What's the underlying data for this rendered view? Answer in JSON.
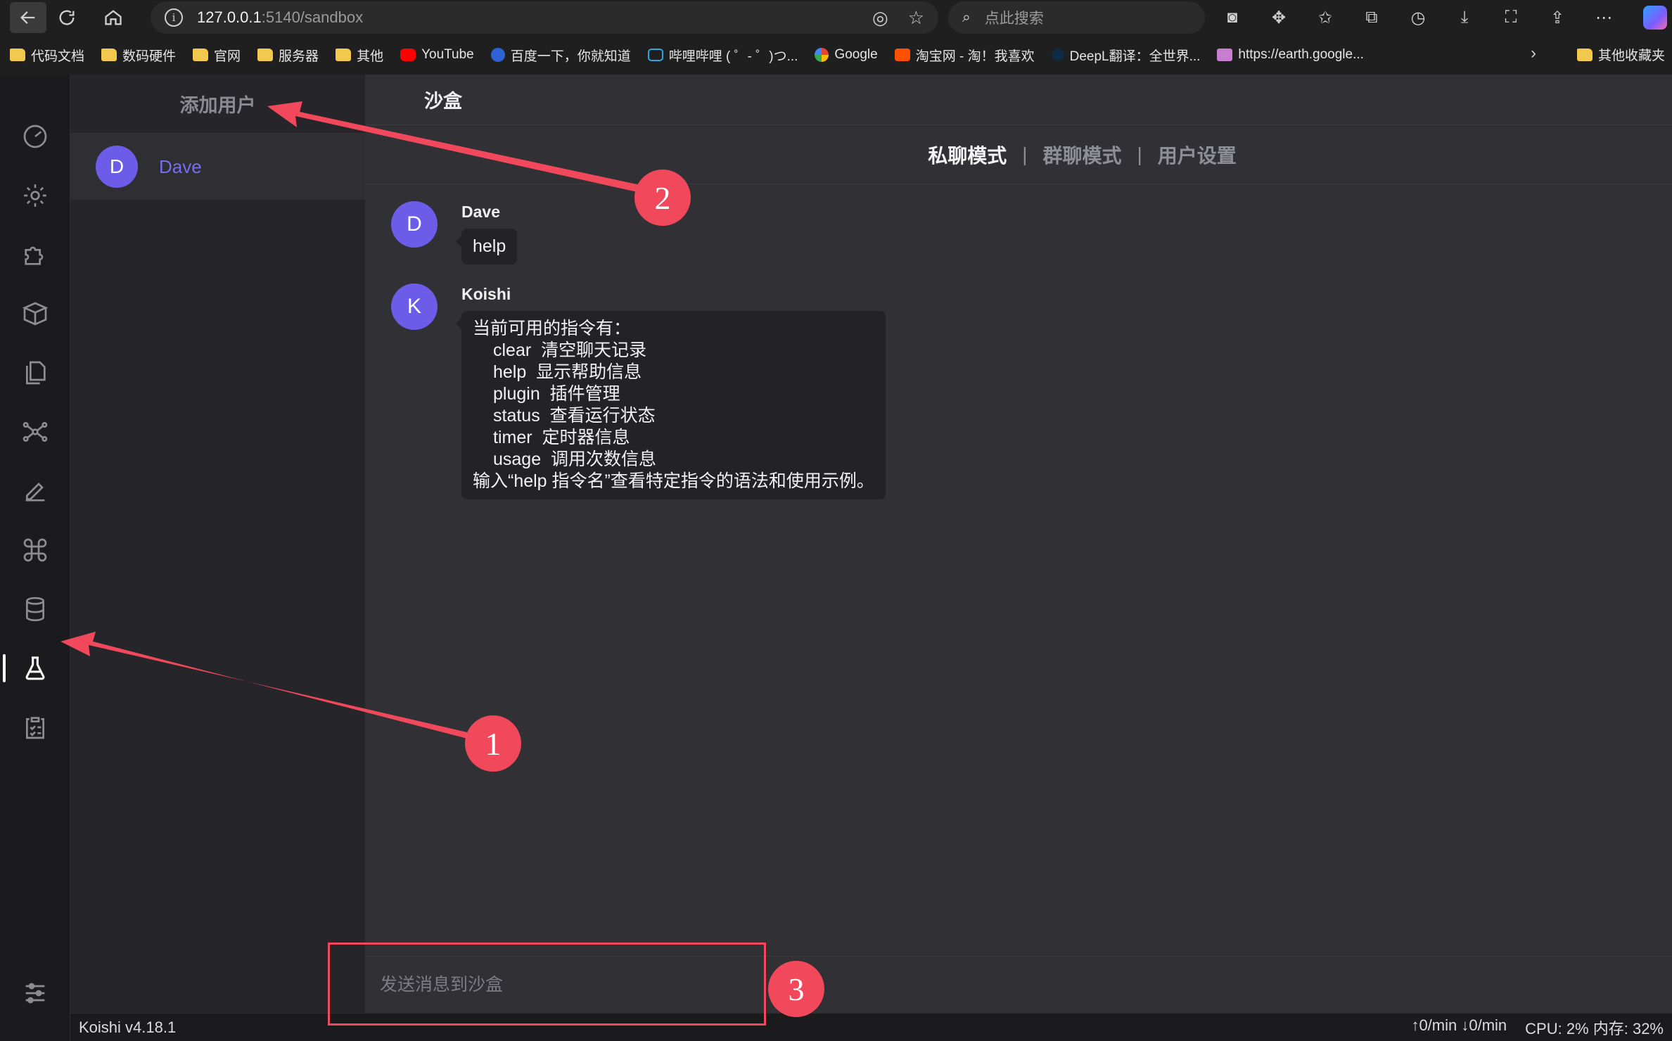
{
  "browser": {
    "url_host": "127.0.0.1",
    "url_path": ":5140/sandbox",
    "search_placeholder": "点此搜索",
    "bookmarks": [
      {
        "label": "代码文档",
        "icon": "folder-icon"
      },
      {
        "label": "数码硬件",
        "icon": "folder-icon"
      },
      {
        "label": "官网",
        "icon": "folder-icon"
      },
      {
        "label": "服务器",
        "icon": "folder-icon"
      },
      {
        "label": "其他",
        "icon": "folder-icon"
      },
      {
        "label": "YouTube",
        "icon": "youtube-icon"
      },
      {
        "label": "百度一下，你就知道",
        "icon": "baidu-icon"
      },
      {
        "label": "哔哩哔哩 ( ゜- ゜)つ...",
        "icon": "bilibili-icon"
      },
      {
        "label": "Google",
        "icon": "google-icon"
      },
      {
        "label": "淘宝网 - 淘！我喜欢",
        "icon": "taobao-icon"
      },
      {
        "label": "DeepL翻译：全世界...",
        "icon": "deepl-icon"
      },
      {
        "label": "https://earth.google...",
        "icon": "earth-icon"
      }
    ],
    "other_bookmarks": "其他收藏夹"
  },
  "sidebar": {
    "add_user": "添加用户",
    "users": [
      {
        "initial": "D",
        "name": "Dave"
      }
    ]
  },
  "main": {
    "title": "沙盒",
    "modes": [
      "私聊模式",
      "群聊模式",
      "用户设置"
    ],
    "active_mode": "私聊模式",
    "messages": [
      {
        "initial": "D",
        "sender": "Dave",
        "text": "help"
      },
      {
        "initial": "K",
        "sender": "Koishi",
        "lines": [
          {
            "text": "当前可用的指令有：",
            "indent": false
          },
          {
            "text": "clear  清空聊天记录",
            "indent": true
          },
          {
            "text": "help  显示帮助信息",
            "indent": true
          },
          {
            "text": "plugin  插件管理",
            "indent": true
          },
          {
            "text": "status  查看运行状态",
            "indent": true
          },
          {
            "text": "timer  定时器信息",
            "indent": true
          },
          {
            "text": "usage  调用次数信息",
            "indent": true
          },
          {
            "text": "输入“help 指令名”查看特定指令的语法和使用示例。",
            "indent": false
          }
        ]
      }
    ],
    "composer_placeholder": "发送消息到沙盒"
  },
  "status_bar": {
    "version": "Koishi v4.18.1",
    "upload": "↑0/min",
    "download": "↓0/min",
    "resources": "CPU: 2% 内存: 32%"
  },
  "annotations": {
    "badge_1": "1",
    "badge_2": "2",
    "badge_3": "3"
  },
  "colors": {
    "accent": "#6c5ce7",
    "annotation": "#f2485c",
    "background": "#313135"
  }
}
